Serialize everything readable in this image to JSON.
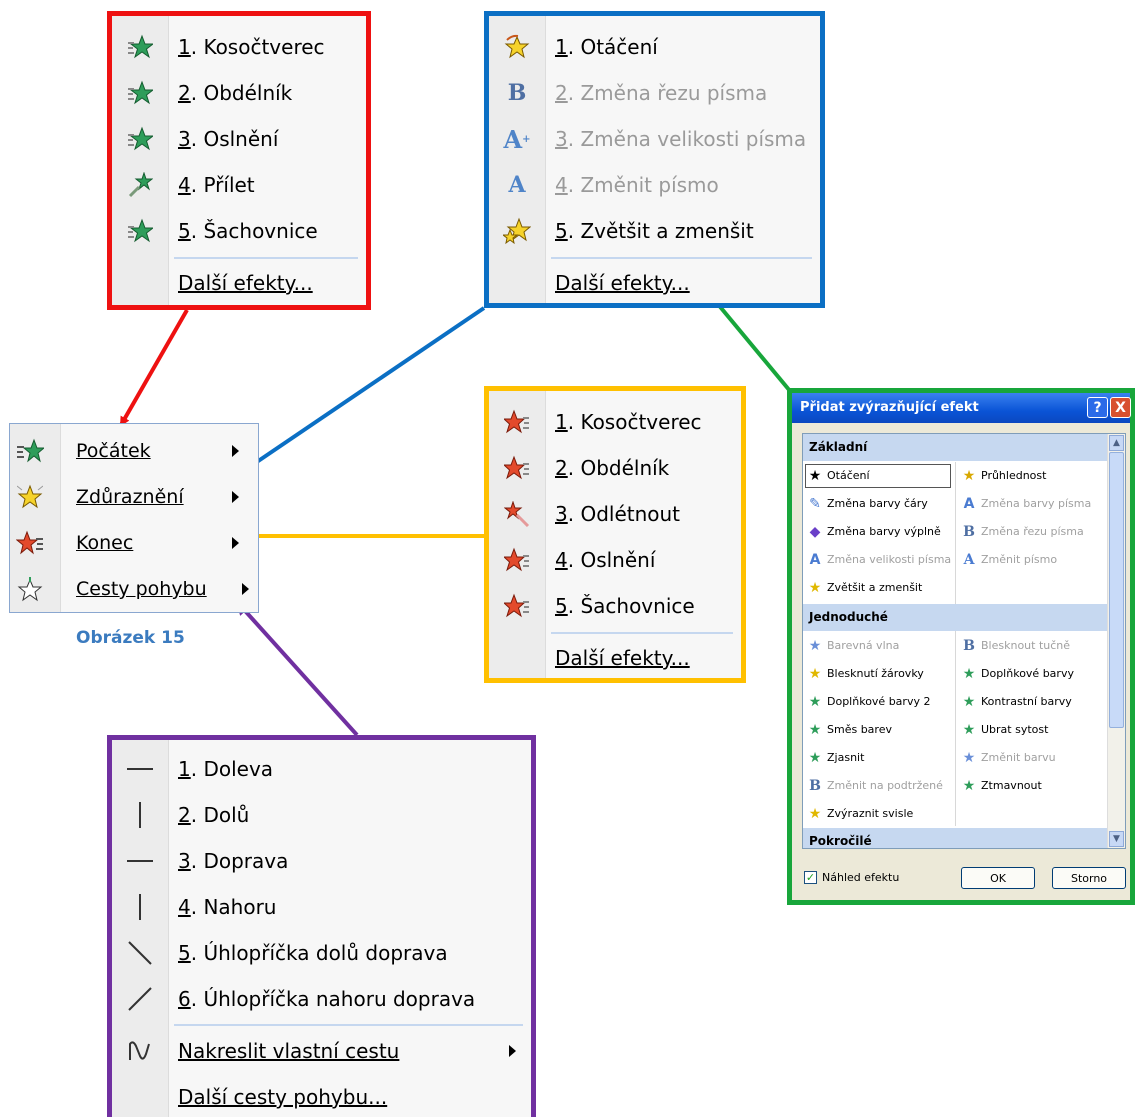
{
  "colors": {
    "red": "#ee1111",
    "blue": "#0b6fc4",
    "yellow": "#ffc000",
    "green": "#18a63b",
    "purple": "#7030a0"
  },
  "entrance_menu": {
    "items": [
      {
        "num": "1",
        "label": ". Kosočtverec",
        "icon": "green-star-icon"
      },
      {
        "num": "2",
        "label": ". Obdélník",
        "icon": "green-star-icon"
      },
      {
        "num": "3",
        "label": ". Oslnění",
        "icon": "green-star-icon"
      },
      {
        "num": "4",
        "label": ". Přílet",
        "icon": "green-star-fly-icon"
      },
      {
        "num": "5",
        "label": ". Šachovnice",
        "icon": "green-star-icon"
      }
    ],
    "more": "Další efekty..."
  },
  "emphasis_menu": {
    "items": [
      {
        "num": "1",
        "label": ". Otáčení",
        "disabled": false,
        "icon": "spin-star-icon"
      },
      {
        "num": "2",
        "label": ". Změna řezu písma",
        "disabled": true,
        "icon": "bold-b-icon"
      },
      {
        "num": "3",
        "label": ". Změna velikosti písma",
        "disabled": true,
        "icon": "font-size-icon"
      },
      {
        "num": "4",
        "label": ". Změnit písmo",
        "disabled": true,
        "icon": "font-a-icon"
      },
      {
        "num": "5",
        "label": ". Zvětšit a zmenšit",
        "disabled": false,
        "icon": "grow-star-icon"
      }
    ],
    "more": "Další efekty..."
  },
  "main_menu": {
    "items": [
      {
        "label": "Počátek",
        "icon": "entrance-star-icon"
      },
      {
        "label": "Zdůraznění",
        "icon": "emphasis-star-icon"
      },
      {
        "label": "Konec",
        "icon": "exit-star-icon"
      },
      {
        "label": "Cesty pohybu",
        "icon": "motion-path-star-icon"
      }
    ],
    "caption": "Obrázek 15"
  },
  "exit_menu": {
    "items": [
      {
        "num": "1",
        "label": ". Kosočtverec",
        "icon": "red-star-icon"
      },
      {
        "num": "2",
        "label": ". Obdélník",
        "icon": "red-star-icon"
      },
      {
        "num": "3",
        "label": ". Odlétnout",
        "icon": "red-star-fly-icon"
      },
      {
        "num": "4",
        "label": ". Oslnění",
        "icon": "red-star-icon"
      },
      {
        "num": "5",
        "label": ". Šachovnice",
        "icon": "red-star-icon"
      }
    ],
    "more": "Další efekty..."
  },
  "motion_menu": {
    "items": [
      {
        "num": "1",
        "label": ". Doleva",
        "icon": "line-horizontal-icon"
      },
      {
        "num": "2",
        "label": ". Dolů",
        "icon": "line-vertical-icon"
      },
      {
        "num": "3",
        "label": ". Doprava",
        "icon": "line-horizontal-icon"
      },
      {
        "num": "4",
        "label": ". Nahoru",
        "icon": "line-vertical-icon"
      },
      {
        "num": "5",
        "label": ". Úhlopříčka dolů doprava",
        "icon": "diagonal-down-icon"
      },
      {
        "num": "6",
        "label": ". Úhlopříčka nahoru doprava",
        "icon": "diagonal-up-icon"
      }
    ],
    "custom": "Nakreslit vlastní cestu",
    "more": "Další cesty pohybu..."
  },
  "dialog": {
    "title": "Přidat zvýrazňující efekt",
    "help": "?",
    "close": "X",
    "categories": [
      "Základní",
      "Jednoduché",
      "Pokročilé"
    ],
    "basic": [
      {
        "label": "Otáčení",
        "disabled": false
      },
      {
        "label": "Průhlednost",
        "disabled": false
      },
      {
        "label": "Změna barvy čáry",
        "disabled": false
      },
      {
        "label": "Změna barvy písma",
        "disabled": true
      },
      {
        "label": "Změna barvy výplně",
        "disabled": false
      },
      {
        "label": "Změna řezu písma",
        "disabled": true
      },
      {
        "label": "Změna velikosti písma",
        "disabled": true
      },
      {
        "label": "Změnit písmo",
        "disabled": true
      },
      {
        "label": "Zvětšit a zmenšit",
        "disabled": false
      }
    ],
    "simple": [
      {
        "label": "Barevná vlna",
        "disabled": true
      },
      {
        "label": "Blesknout tučně",
        "disabled": true
      },
      {
        "label": "Blesknutí žárovky",
        "disabled": false
      },
      {
        "label": "Doplňkové barvy",
        "disabled": false
      },
      {
        "label": "Doplňkové barvy 2",
        "disabled": false
      },
      {
        "label": "Kontrastní barvy",
        "disabled": false
      },
      {
        "label": "Směs barev",
        "disabled": false
      },
      {
        "label": "Ubrat sytost",
        "disabled": false
      },
      {
        "label": "Zjasnit",
        "disabled": false
      },
      {
        "label": "Změnit barvu",
        "disabled": true
      },
      {
        "label": "Změnit na podtržené",
        "disabled": true
      },
      {
        "label": "Ztmavnout",
        "disabled": false
      },
      {
        "label": "Zvýraznit svisle",
        "disabled": false
      }
    ],
    "preview_label": "Náhled efektu",
    "preview_checked": true,
    "ok": "OK",
    "cancel": "Storno"
  }
}
